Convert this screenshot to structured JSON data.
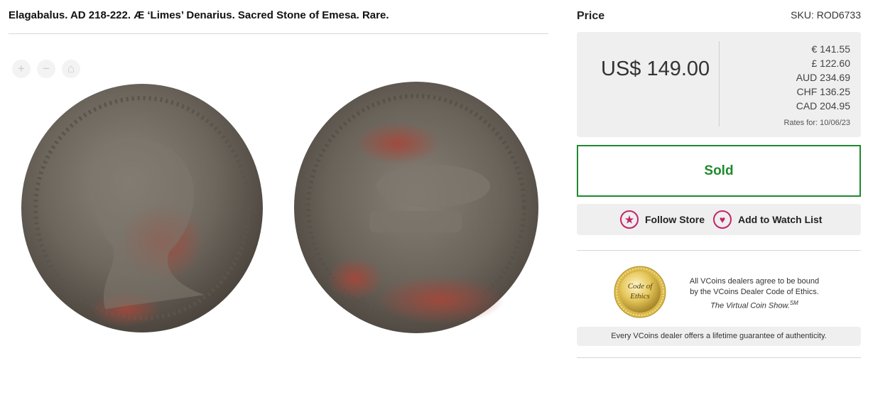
{
  "listing": {
    "title": "Elagabalus. AD 218-222. Æ ‘Limes’ Denarius. Sacred Stone of Emesa. Rare."
  },
  "viewer": {
    "zoom_in": "+",
    "zoom_out": "−",
    "home": "⌂"
  },
  "price": {
    "label": "Price",
    "sku": "SKU: ROD6733",
    "main": "US$ 149.00",
    "conversions": [
      "€ 141.55",
      "£ 122.60",
      "AUD 234.69",
      "CHF 136.25",
      "CAD 204.95"
    ],
    "rates_date": "Rates for: 10/06/23"
  },
  "status": {
    "sold_label": "Sold",
    "color": "#1f8a2e"
  },
  "actions": {
    "follow_label": "Follow Store",
    "watch_label": "Add to Watch List",
    "accent": "#c4256a"
  },
  "ethics": {
    "seal_line1": "Code of",
    "seal_line2": "Ethics",
    "text_line1": "All VCoins dealers agree to be bound",
    "text_line2": "by the VCoins Dealer Code of Ethics.",
    "text_line3": "The Virtual Coin Show.",
    "text_sup": "SM"
  },
  "guarantee": {
    "text": "Every VCoins dealer offers a lifetime guarantee of authenticity."
  }
}
